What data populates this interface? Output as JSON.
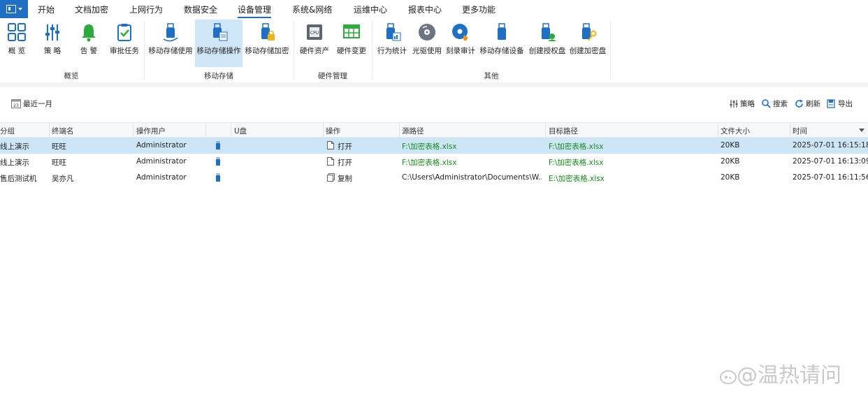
{
  "menu": {
    "tabs": [
      "开始",
      "文档加密",
      "上网行为",
      "数据安全",
      "设备管理",
      "系统&网络",
      "运维中心",
      "报表中心",
      "更多功能"
    ],
    "active_tab": "设备管理"
  },
  "ribbon": {
    "buttons": [
      {
        "label": "概 览",
        "icon": "dashboard-grid-icon"
      },
      {
        "label": "策 略",
        "icon": "policy-sliders-icon"
      },
      {
        "label": "告 警",
        "icon": "bell-icon"
      },
      {
        "label": "审批任务",
        "icon": "clipboard-check-icon"
      },
      {
        "label": "移动存储使用",
        "icon": "usb-drive-icon"
      },
      {
        "label": "移动存储操作",
        "icon": "usb-operation-icon"
      },
      {
        "label": "移动存储加密",
        "icon": "usb-lock-icon"
      },
      {
        "label": "硬件资产",
        "icon": "cpu-icon"
      },
      {
        "label": "硬件变更",
        "icon": "hardware-change-icon"
      },
      {
        "label": "行为统计",
        "icon": "usb-stats-icon"
      },
      {
        "label": "光驱使用",
        "icon": "optical-disc-icon"
      },
      {
        "label": "刻录审计",
        "icon": "disc-burn-icon"
      },
      {
        "label": "移动存储设备",
        "icon": "usb-device-icon"
      },
      {
        "label": "创建授权盘",
        "icon": "usb-authorize-icon"
      },
      {
        "label": "创建加密盘",
        "icon": "usb-key-icon"
      }
    ],
    "selected_button": "移动存储操作",
    "groups": [
      "概览",
      "移动存储",
      "硬件管理",
      "其他"
    ]
  },
  "toolbar": {
    "date_range": "最近一月",
    "calendar_day": "23",
    "strategy": "策略",
    "search": "搜索",
    "refresh": "刷新",
    "export": "导出"
  },
  "table": {
    "columns": [
      "分组",
      "终端名",
      "操作用户",
      "U盘",
      "操作",
      "源路径",
      "目标路径",
      "文件大小",
      "时间"
    ],
    "rows": [
      {
        "group": "线上演示",
        "terminal": "旺旺",
        "user": "Administrator",
        "operation": "打开",
        "source": "F:\\加密表格.xlsx",
        "target": "F:\\加密表格.xlsx",
        "size": "20KB",
        "time": "2025-07-01 16:15:18"
      },
      {
        "group": "线上演示",
        "terminal": "旺旺",
        "user": "Administrator",
        "operation": "打开",
        "source": "F:\\加密表格.xlsx",
        "target": "F:\\加密表格.xlsx",
        "size": "20KB",
        "time": "2025-07-01 16:13:09"
      },
      {
        "group": "售后测试机",
        "terminal": "吴亦凡",
        "user": "Administrator",
        "operation": "复制",
        "source": "C:\\Users\\Administrator\\Documents\\W...",
        "target": "E:\\加密表格.xlsx",
        "size": "20KB",
        "time": "2025-07-01 16:11:56"
      }
    ],
    "selected_row": 0
  },
  "watermark": "@温热请问",
  "colors": {
    "accent": "#1f6fc5",
    "selected_row": "#cde6f7",
    "ribbon_selected": "#cfe5f8",
    "path_green": "#1a8a1a"
  }
}
